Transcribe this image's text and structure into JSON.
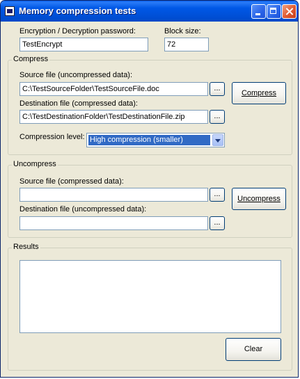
{
  "window": {
    "title": "Memory compression tests"
  },
  "password": {
    "label": "Encryption / Decryption password:",
    "value": "TestEncrypt"
  },
  "blocksize": {
    "label": "Block size:",
    "value": "72"
  },
  "compress": {
    "group_title": "Compress",
    "source_label": "Source file (uncompressed data):",
    "source_value": "C:\\TestSourceFolder\\TestSourceFile.doc",
    "dest_label": "Destination file (compressed data):",
    "dest_value": "C:\\TestDestinationFolder\\TestDestinationFile.zip",
    "browse_label": "...",
    "button_label": "Compress",
    "level_label": "Compression level:",
    "level_value": "High compression (smaller)"
  },
  "uncompress": {
    "group_title": "Uncompress",
    "source_label": "Source file (compressed data):",
    "source_value": "",
    "dest_label": "Destination file (uncompressed data):",
    "dest_value": "",
    "browse_label": "...",
    "button_label": "Uncompress"
  },
  "results": {
    "group_title": "Results",
    "text": "",
    "clear_label": "Clear"
  },
  "colors": {
    "titlebar": "#0058e6",
    "selection": "#316ac5",
    "face": "#ece9d8"
  },
  "icons": [
    "app-icon",
    "minimize-icon",
    "maximize-icon",
    "close-icon",
    "dropdown-arrow-icon"
  ]
}
